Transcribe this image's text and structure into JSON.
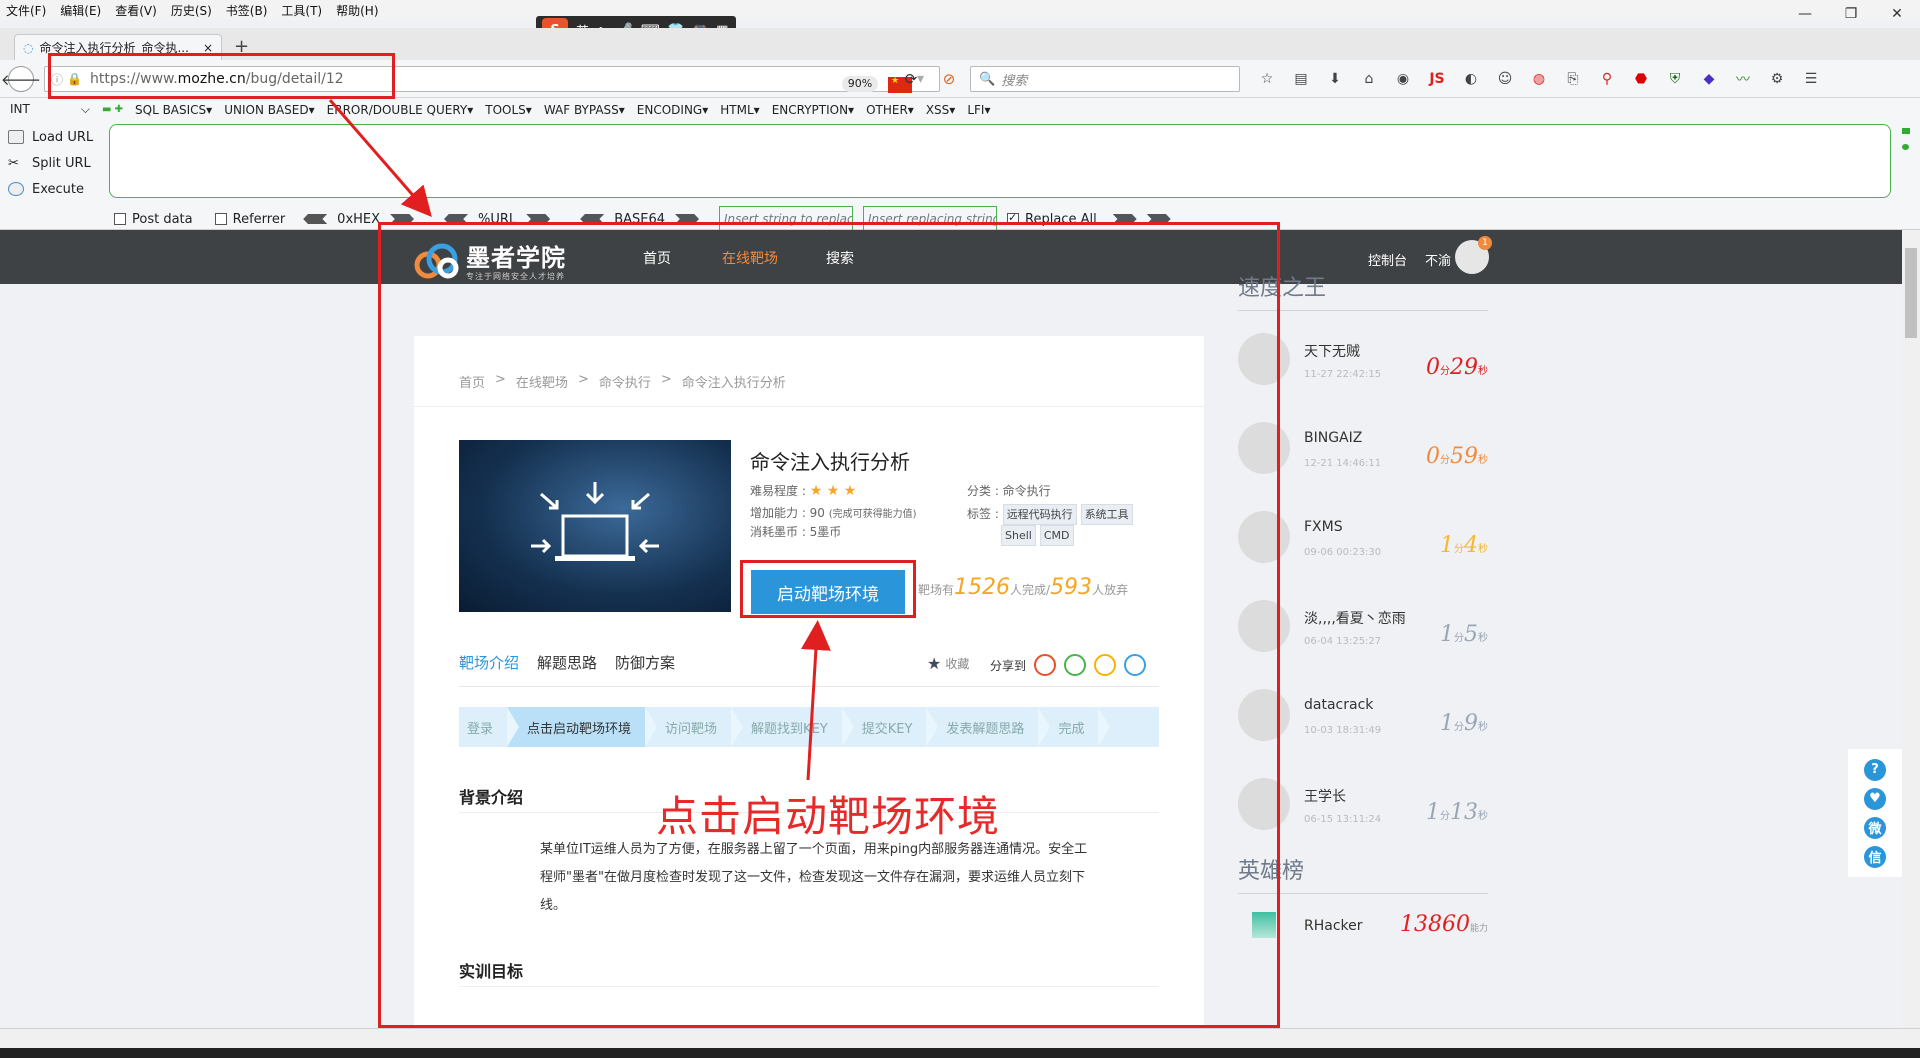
{
  "menubar": [
    "文件(F)",
    "编辑(E)",
    "查看(V)",
    "历史(S)",
    "书签(B)",
    "工具(T)",
    "帮助(H)"
  ],
  "ime": {
    "logo": "S",
    "mode": "英"
  },
  "tab": {
    "title": "命令注入执行分析_命令执...",
    "close": "×",
    "new": "+"
  },
  "navbar": {
    "url_prefix": "https://www.",
    "url_domain": "mozhe.cn",
    "url_path": "/bug/detail/12",
    "zoom": "90%",
    "search_placeholder": "搜索"
  },
  "hackbar": {
    "int_label": "INT",
    "menus": [
      "SQL BASICS▾",
      "UNION BASED▾",
      "ERROR/DOUBLE QUERY▾",
      "TOOLS▾",
      "WAF BYPASS▾",
      "ENCODING▾",
      "HTML▾",
      "ENCRYPTION▾",
      "OTHER▾",
      "XSS▾",
      "LFI▾"
    ],
    "load_url": "Load URL",
    "split_url": "Split URL",
    "execute": "Execute",
    "post_data": "Post data",
    "referrer": "Referrer",
    "hex": "0xHEX",
    "url_enc": "%URL",
    "base64": "BASE64",
    "insert_replace": "Insert string to replace",
    "insert_replacing": "Insert replacing string",
    "replace_all": "Replace All"
  },
  "site": {
    "logo_name": "墨者学院",
    "logo_sub": "专注于网络安全人才培养",
    "nav_home": "首页",
    "nav_range": "在线靶场",
    "nav_search": "搜索",
    "console": "控制台",
    "user": "不渝",
    "badge": "1"
  },
  "course": {
    "breadcrumb": [
      "首页",
      ">",
      "在线靶场",
      ">",
      "命令执行",
      ">",
      "命令注入执行分析"
    ],
    "title": "命令注入执行分析",
    "difficulty_label": "难易程度 :",
    "difficulty_stars": "★ ★ ★",
    "ability": "增加能力 : 90",
    "ability_note": "(完成可获得能力值)",
    "cost": "消耗墨币 : 5墨币",
    "category": "分类 : 命令执行",
    "tags_label": "标签 :",
    "tags": [
      "远程代码执行",
      "系统工具",
      "Shell",
      "CMD"
    ],
    "start_button": "启动靶场环境",
    "stats_prefix": "靶场有",
    "completed": "1526",
    "completed_suffix": "人完成/",
    "abandoned": "593",
    "abandoned_suffix": "人放弃",
    "tabs": [
      "靶场介绍",
      "解题思路",
      "防御方案"
    ],
    "collect": "收藏",
    "share": "分享到",
    "steps": [
      "登录",
      "点击启动靶场环境",
      "访问靶场",
      "解题找到KEY",
      "提交KEY",
      "发表解题思路",
      "完成"
    ],
    "bg_title": "背景介绍",
    "bg_text": "某单位IT运维人员为了方便，在服务器上留了一个页面，用来ping内部服务器连通情况。安全工程师\"墨者\"在做月度检查时发现了这一文件，检查发现这一文件存在漏洞，要求运维人员立刻下线。",
    "goal_title": "实训目标"
  },
  "sidebar": {
    "speed_title": "速度之王",
    "speed": [
      {
        "name": "天下无贼",
        "time": "11-27 22:42:15",
        "min": "0",
        "sec": "29",
        "color": "#e02020"
      },
      {
        "name": "BINGAIZ",
        "time": "12-21 14:46:11",
        "min": "0",
        "sec": "59",
        "color": "#f08a3e"
      },
      {
        "name": "FXMS",
        "time": "09-06 00:23:30",
        "min": "1",
        "sec": "4",
        "color": "#f5b730"
      },
      {
        "name": "淡,,,,看夏丶恋雨",
        "time": "06-04 13:25:27",
        "min": "1",
        "sec": "5",
        "color": "#9aa6b6"
      },
      {
        "name": "datacrack",
        "time": "10-03 18:31:49",
        "min": "1",
        "sec": "9",
        "color": "#9aa6b6"
      },
      {
        "name": "王学长",
        "time": "06-15 13:11:24",
        "min": "1",
        "sec": "13",
        "color": "#9aa6b6"
      }
    ],
    "min_unit": "分",
    "sec_unit": "秒",
    "hero_title": "英雄榜",
    "hero": [
      {
        "name": "RHacker",
        "score": "13860",
        "unit": "能力"
      }
    ]
  },
  "float_tools": [
    "?",
    "♥",
    "微",
    "信"
  ],
  "annotation": {
    "label": "点击启动靶场环境",
    "color": "#e02020"
  }
}
